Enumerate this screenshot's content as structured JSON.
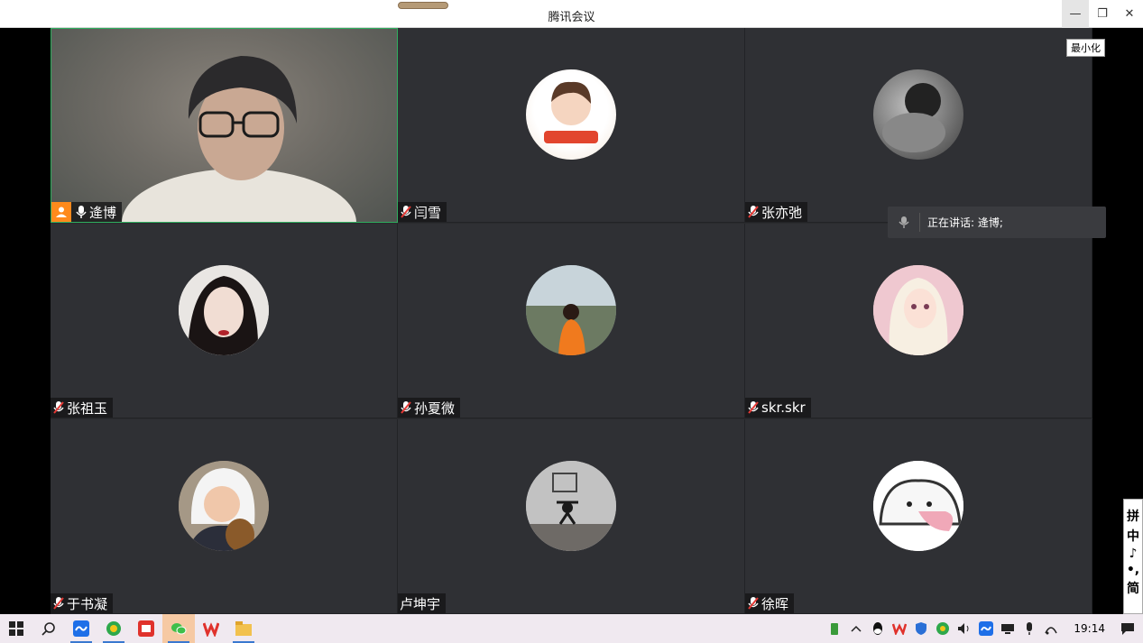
{
  "window": {
    "title": "腾讯会议",
    "minimize_tooltip": "最小化",
    "minimize_symbol": "—",
    "maximize_symbol": "❐",
    "close_symbol": "✕"
  },
  "participants": [
    {
      "name": "逄博",
      "host": true,
      "video": true
    },
    {
      "name": "闫雪",
      "muted": true
    },
    {
      "name": "张亦弛",
      "muted": true
    },
    {
      "name": "张祖玉",
      "muted": true
    },
    {
      "name": "孙夏微",
      "muted": true
    },
    {
      "name": "skr.skr",
      "muted": true
    },
    {
      "name": "于书凝",
      "muted": true
    },
    {
      "name": "卢坤宇",
      "muted": false
    },
    {
      "name": "徐晖",
      "muted": true
    }
  ],
  "speaking": {
    "label": "正在讲话: 逄博;"
  },
  "ime": {
    "chars": [
      "拼",
      "中",
      "♪",
      "•,",
      "简"
    ]
  },
  "taskbar": {
    "clock": "19:14",
    "pinned_icons": [
      "windows-start-icon",
      "search-icon",
      "tencent-meeting-icon",
      "360-browser-icon",
      "red-app-icon",
      "wechat-icon",
      "wps-icon",
      "file-explorer-icon"
    ]
  }
}
